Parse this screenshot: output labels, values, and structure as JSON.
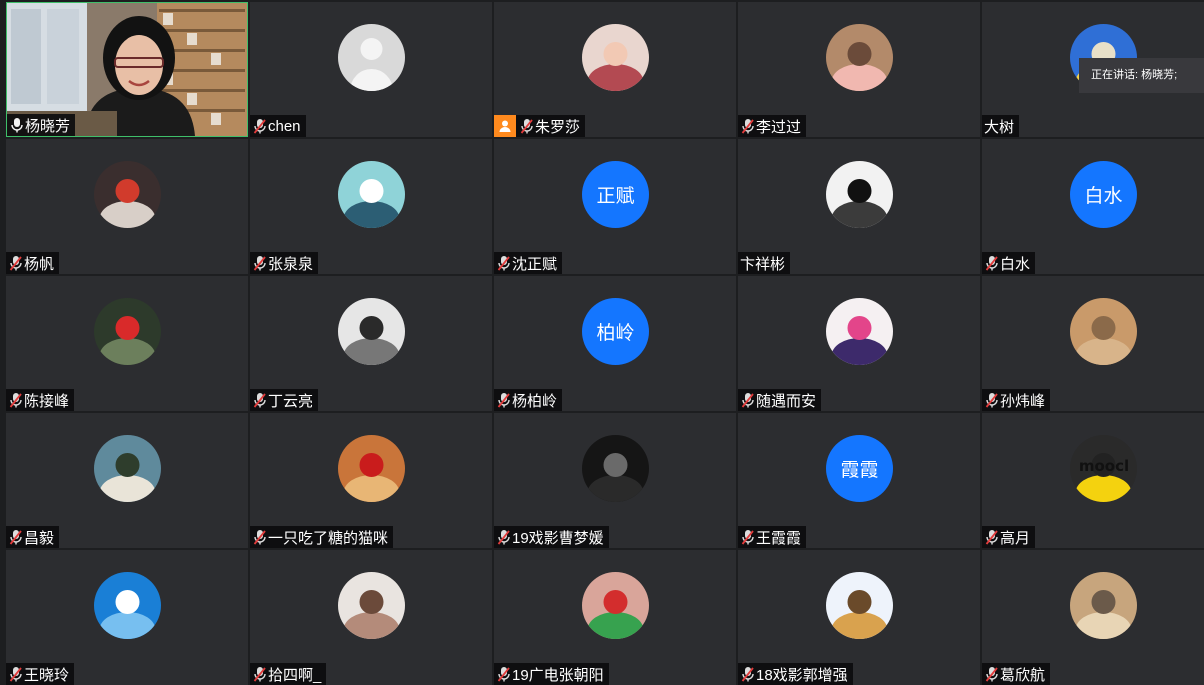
{
  "active_speaker": "正在讲话: 杨晓芳;",
  "colors": {
    "tile": "#2c2d30",
    "speaking_border": "#3fbf6a",
    "initials_bg": "#1476ff",
    "host_badge": "#ff8a1e"
  },
  "participants": [
    {
      "name": "杨晓芳",
      "mic": "on",
      "view": "video",
      "speaking": true
    },
    {
      "name": "chen",
      "mic": "muted",
      "view": "default-silhouette"
    },
    {
      "name": "朱罗莎",
      "mic": "muted",
      "view": "photo",
      "host": true,
      "host_icon": "person-icon"
    },
    {
      "name": "李过过",
      "mic": "muted",
      "view": "photo"
    },
    {
      "name": "大树",
      "mic": "none",
      "view": "photo"
    },
    {
      "name": "杨帆",
      "mic": "muted",
      "view": "photo"
    },
    {
      "name": "张泉泉",
      "mic": "muted",
      "view": "photo"
    },
    {
      "name": "沈正赋",
      "mic": "muted",
      "view": "initials",
      "initials": "正赋"
    },
    {
      "name": "卞祥彬",
      "mic": "none",
      "view": "photo"
    },
    {
      "name": "白水",
      "mic": "muted",
      "view": "initials",
      "initials": "白水"
    },
    {
      "name": "陈接峰",
      "mic": "muted",
      "view": "photo"
    },
    {
      "name": "丁云亮",
      "mic": "muted",
      "view": "photo"
    },
    {
      "name": "杨柏岭",
      "mic": "muted",
      "view": "initials",
      "initials": "柏岭"
    },
    {
      "name": "随遇而安",
      "mic": "muted",
      "view": "photo"
    },
    {
      "name": "孙炜峰",
      "mic": "muted",
      "view": "photo"
    },
    {
      "name": "昌毅",
      "mic": "muted",
      "view": "photo"
    },
    {
      "name": "一只吃了糖的猫咪",
      "mic": "muted",
      "view": "photo"
    },
    {
      "name": "19戏影曹梦媛",
      "mic": "muted",
      "view": "photo"
    },
    {
      "name": "王霞霞",
      "mic": "muted",
      "view": "initials",
      "initials": "霞霞"
    },
    {
      "name": "高月",
      "mic": "muted",
      "view": "photo",
      "photo_text": "moocl"
    },
    {
      "name": "王晓玲",
      "mic": "muted",
      "view": "photo"
    },
    {
      "name": "拾四啊_",
      "mic": "muted",
      "view": "photo"
    },
    {
      "name": "19广电张朝阳",
      "mic": "muted",
      "view": "photo"
    },
    {
      "name": "18戏影郭增强",
      "mic": "muted",
      "view": "photo"
    },
    {
      "name": "葛欣航",
      "mic": "muted",
      "view": "photo"
    }
  ]
}
